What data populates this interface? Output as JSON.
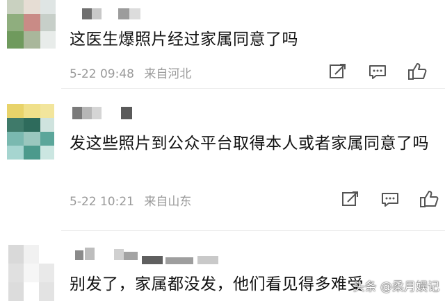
{
  "comments": [
    {
      "text": "这医生爆照片经过家属同意了吗",
      "date": "5-22 09:48",
      "location": "来自河北"
    },
    {
      "text": "发这些照片到公众平台取得本人或者家属同意了吗",
      "date": "5-22 10:21",
      "location": "来自山东"
    },
    {
      "text": "别发了，家属都没发，他们看见得多难受"
    }
  ],
  "icons": {
    "edit": "share-edit-icon",
    "comment": "comment-icon",
    "like": "thumbs-up-icon"
  },
  "watermark": "头条 @柔月娱记",
  "colors": {
    "meta_text": "#9a9a9a",
    "icon_stroke": "#555555"
  }
}
